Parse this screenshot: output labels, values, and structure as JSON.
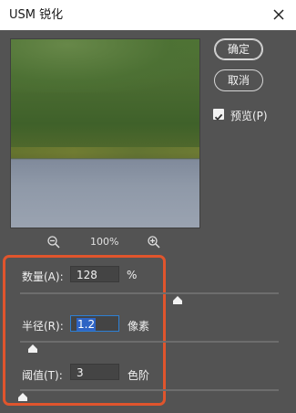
{
  "window": {
    "title": "USM 锐化"
  },
  "buttons": {
    "ok": "确定",
    "cancel": "取消"
  },
  "preview": {
    "label": "预览(P)",
    "checked": true
  },
  "zoom": {
    "value": "100%",
    "zoom_out_icon": "zoom-out-icon",
    "zoom_in_icon": "zoom-in-icon"
  },
  "fields": {
    "amount": {
      "label": "数量(A):",
      "value": "128",
      "unit": "%",
      "slider_fraction": 0.61
    },
    "radius": {
      "label": "半径(R):",
      "value": "1.2",
      "unit": "像素",
      "slider_fraction": 0.05
    },
    "threshold": {
      "label": "阈值(T):",
      "value": "3",
      "unit": "色阶",
      "slider_fraction": 0.01
    }
  },
  "colors": {
    "highlight_border": "#e0552d",
    "selection": "#2f64c4",
    "background": "#535353"
  }
}
